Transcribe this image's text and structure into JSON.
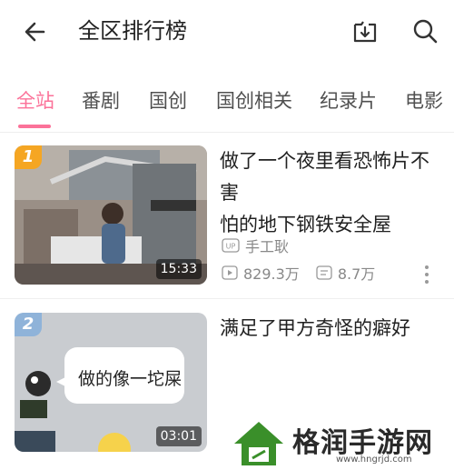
{
  "header": {
    "title": "全区排行榜",
    "icons": [
      "back-arrow-icon",
      "download-icon",
      "search-icon"
    ]
  },
  "tabs": [
    {
      "label": "全站",
      "active": true
    },
    {
      "label": "番剧",
      "active": false
    },
    {
      "label": "国创",
      "active": false
    },
    {
      "label": "国创相关",
      "active": false
    },
    {
      "label": "纪录片",
      "active": false
    },
    {
      "label": "电影",
      "active": false
    }
  ],
  "accent_color": "#fb7299",
  "videos": [
    {
      "rank": "1",
      "rank_color": "#f5a623",
      "title_line1": "做了一个夜里看恐怖片不害",
      "title_line2": "怕的地下钢铁安全屋",
      "up_badge": "UP",
      "author": "手工耿",
      "duration": "15:33",
      "views": "829.3万",
      "danmaku": "8.7万"
    },
    {
      "rank": "2",
      "rank_color": "#8fb3d9",
      "title_line1": "满足了甲方奇怪的癖好",
      "thumb_caption": "做的像一坨屎",
      "duration": "03:01"
    }
  ],
  "watermark": {
    "site_name": "格润手游网",
    "site_url": "www.hngrjd.com"
  }
}
